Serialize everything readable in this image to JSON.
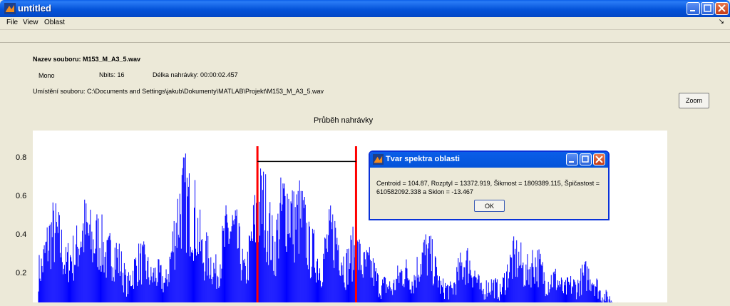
{
  "window": {
    "title": "untitled"
  },
  "menu": {
    "items": [
      "File",
      "View",
      "Oblast"
    ]
  },
  "file_info": {
    "name_label": "Nazev souboru: M153_M_A3_5.wav",
    "channels": "Mono",
    "nbits": "Nbits: 16",
    "duration": "Délka nahrávky: 00:00:02.457",
    "location": "Umístění souboru: C:\\Documents and Settings\\jakub\\Dokumenty\\MATLAB\\Projekt\\M153_M_A3_5.wav"
  },
  "zoom_button": "Zoom",
  "chart_data": {
    "type": "bar",
    "title": "Průběh nahrávky",
    "ylim": [
      0,
      0.9
    ],
    "yticks": [
      "0.8",
      "0.6",
      "0.4",
      "0.2"
    ],
    "ytick_values": [
      0.8,
      0.6,
      0.4,
      0.2
    ],
    "series_color": "#0000ff",
    "selection_color": "#ff0000",
    "selection_line_level": 0.78,
    "envelope_peaks": [
      {
        "x": 0.01,
        "y": 0.35
      },
      {
        "x": 0.025,
        "y": 0.6
      },
      {
        "x": 0.04,
        "y": 0.28
      },
      {
        "x": 0.055,
        "y": 0.42
      },
      {
        "x": 0.075,
        "y": 0.62
      },
      {
        "x": 0.095,
        "y": 0.55
      },
      {
        "x": 0.12,
        "y": 0.45
      },
      {
        "x": 0.14,
        "y": 0.15
      },
      {
        "x": 0.165,
        "y": 0.38
      },
      {
        "x": 0.19,
        "y": 0.28
      },
      {
        "x": 0.235,
        "y": 0.85
      },
      {
        "x": 0.245,
        "y": 0.77
      },
      {
        "x": 0.27,
        "y": 0.42
      },
      {
        "x": 0.285,
        "y": 0.3
      },
      {
        "x": 0.31,
        "y": 0.62
      },
      {
        "x": 0.335,
        "y": 0.25
      },
      {
        "x": 0.36,
        "y": 0.8
      },
      {
        "x": 0.4,
        "y": 0.82
      },
      {
        "x": 0.42,
        "y": 0.72
      },
      {
        "x": 0.44,
        "y": 0.45
      },
      {
        "x": 0.475,
        "y": 0.58
      },
      {
        "x": 0.51,
        "y": 0.45
      },
      {
        "x": 0.53,
        "y": 0.35
      },
      {
        "x": 0.56,
        "y": 0.2
      },
      {
        "x": 0.59,
        "y": 0.3
      },
      {
        "x": 0.625,
        "y": 0.44
      },
      {
        "x": 0.655,
        "y": 0.18
      },
      {
        "x": 0.69,
        "y": 0.37
      },
      {
        "x": 0.73,
        "y": 0.2
      },
      {
        "x": 0.77,
        "y": 0.4
      },
      {
        "x": 0.8,
        "y": 0.37
      },
      {
        "x": 0.83,
        "y": 0.25
      },
      {
        "x": 0.86,
        "y": 0.2
      },
      {
        "x": 0.885,
        "y": 0.28
      },
      {
        "x": 0.91,
        "y": 0.12
      },
      {
        "x": 0.95,
        "y": 0.05
      }
    ],
    "selection_start_fraction": 0.353,
    "selection_end_fraction": 0.512
  },
  "dialog": {
    "title": "Tvar spektra oblasti",
    "message": "Centroid = 104.87, Rozptyl = 13372.919, Šikmost = 1809389.115, Špičastost = 610582092.338 a Sklon = -13.467",
    "ok_label": "OK"
  }
}
